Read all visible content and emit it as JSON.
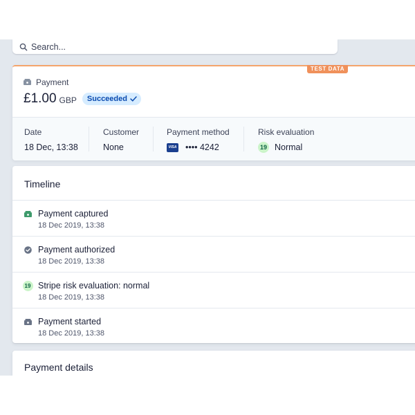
{
  "search": {
    "placeholder": "Search..."
  },
  "summary": {
    "test_badge": "TEST DATA",
    "label": "Payment",
    "amount": "£1.00",
    "currency": "GBP",
    "status": "Succeeded",
    "facts": [
      {
        "key": "Date",
        "value": "18 Dec, 13:38"
      },
      {
        "key": "Customer",
        "value": "None"
      },
      {
        "key": "Payment method",
        "value": "•••• 4242",
        "brand": "VISA"
      },
      {
        "key": "Risk evaluation",
        "value": "Normal",
        "score": "19"
      }
    ]
  },
  "timeline": {
    "title": "Timeline",
    "events": [
      {
        "title": "Payment captured",
        "time": "18 Dec 2019, 13:38",
        "icon": "money-icon"
      },
      {
        "title": "Payment authorized",
        "time": "18 Dec 2019, 13:38",
        "icon": "check-circle-icon"
      },
      {
        "title": "Stripe risk evaluation: normal",
        "time": "18 Dec 2019, 13:38",
        "icon": "risk-score-icon",
        "score": "19"
      },
      {
        "title": "Payment started",
        "time": "18 Dec 2019, 13:38",
        "icon": "money-icon"
      }
    ]
  },
  "details": {
    "title": "Payment details"
  },
  "colors": {
    "backdrop": "#e3e8ee",
    "test_badge": "#f0915b",
    "status_bg": "#d6ecff",
    "status_text": "#0a4bb0",
    "captured_icon": "#3d9a6b",
    "neutral_icon": "#697386",
    "risk_bg": "#cbf4c9",
    "visa_bg": "#1a3f8f"
  }
}
